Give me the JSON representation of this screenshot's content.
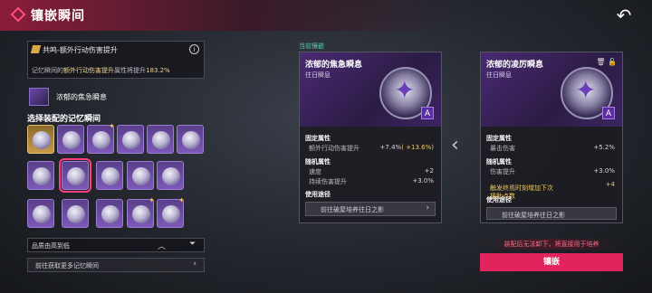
{
  "header": {
    "title": "镶嵌瞬间"
  },
  "left": {
    "passive": {
      "title": "共鸣-额外行动伤害提升",
      "desc_prefix": "记忆瞬间的",
      "desc_hl": "额外行动伤害提升",
      "desc_mid": "属性将提升",
      "desc_value": "183.2%"
    },
    "current": {
      "name": "浓郁的焦急瞬息"
    },
    "grid_title": "选择装配的记忆瞬间",
    "sort_label": "品质由高到低",
    "get_more": "前往获取更多记忆瞬间"
  },
  "current_tag": "当前镶嵌",
  "card_left": {
    "name": "浓郁的焦急瞬息",
    "sub": "往日瞬息",
    "fixed_title": "固定属性",
    "fixed": [
      {
        "label": "额外行动伤害提升",
        "value": "+7.4%",
        "bonus": "( +13.6%)"
      }
    ],
    "random_title": "随机属性",
    "random": [
      {
        "label": "速度",
        "value": "+2"
      },
      {
        "label": "持续伤害提升",
        "value": "+3.0%"
      }
    ],
    "use_title": "使用途径",
    "use_btn": "前往破屋培养往日之影"
  },
  "card_right": {
    "name": "浓郁的凌厉瞬息",
    "sub": "往日瞬息",
    "fixed_title": "固定属性",
    "fixed": [
      {
        "label": "暴击伤害",
        "value": "+5.2%"
      }
    ],
    "random_title": "随机属性",
    "random": [
      {
        "label": "伤害提升",
        "value": "+3.0%"
      },
      {
        "label": "触发终焉时刻增加下次\n援助点数",
        "value": "+4"
      }
    ],
    "use_title": "使用途径",
    "use_btn": "前往破屋培养往日之影"
  },
  "notice": "装配后无法卸下，将直接用于培养",
  "embed_btn": "镶嵌",
  "colors": {
    "accent": "#e1245c",
    "gold": "#f0c862",
    "purple": "#6a3fb5"
  }
}
